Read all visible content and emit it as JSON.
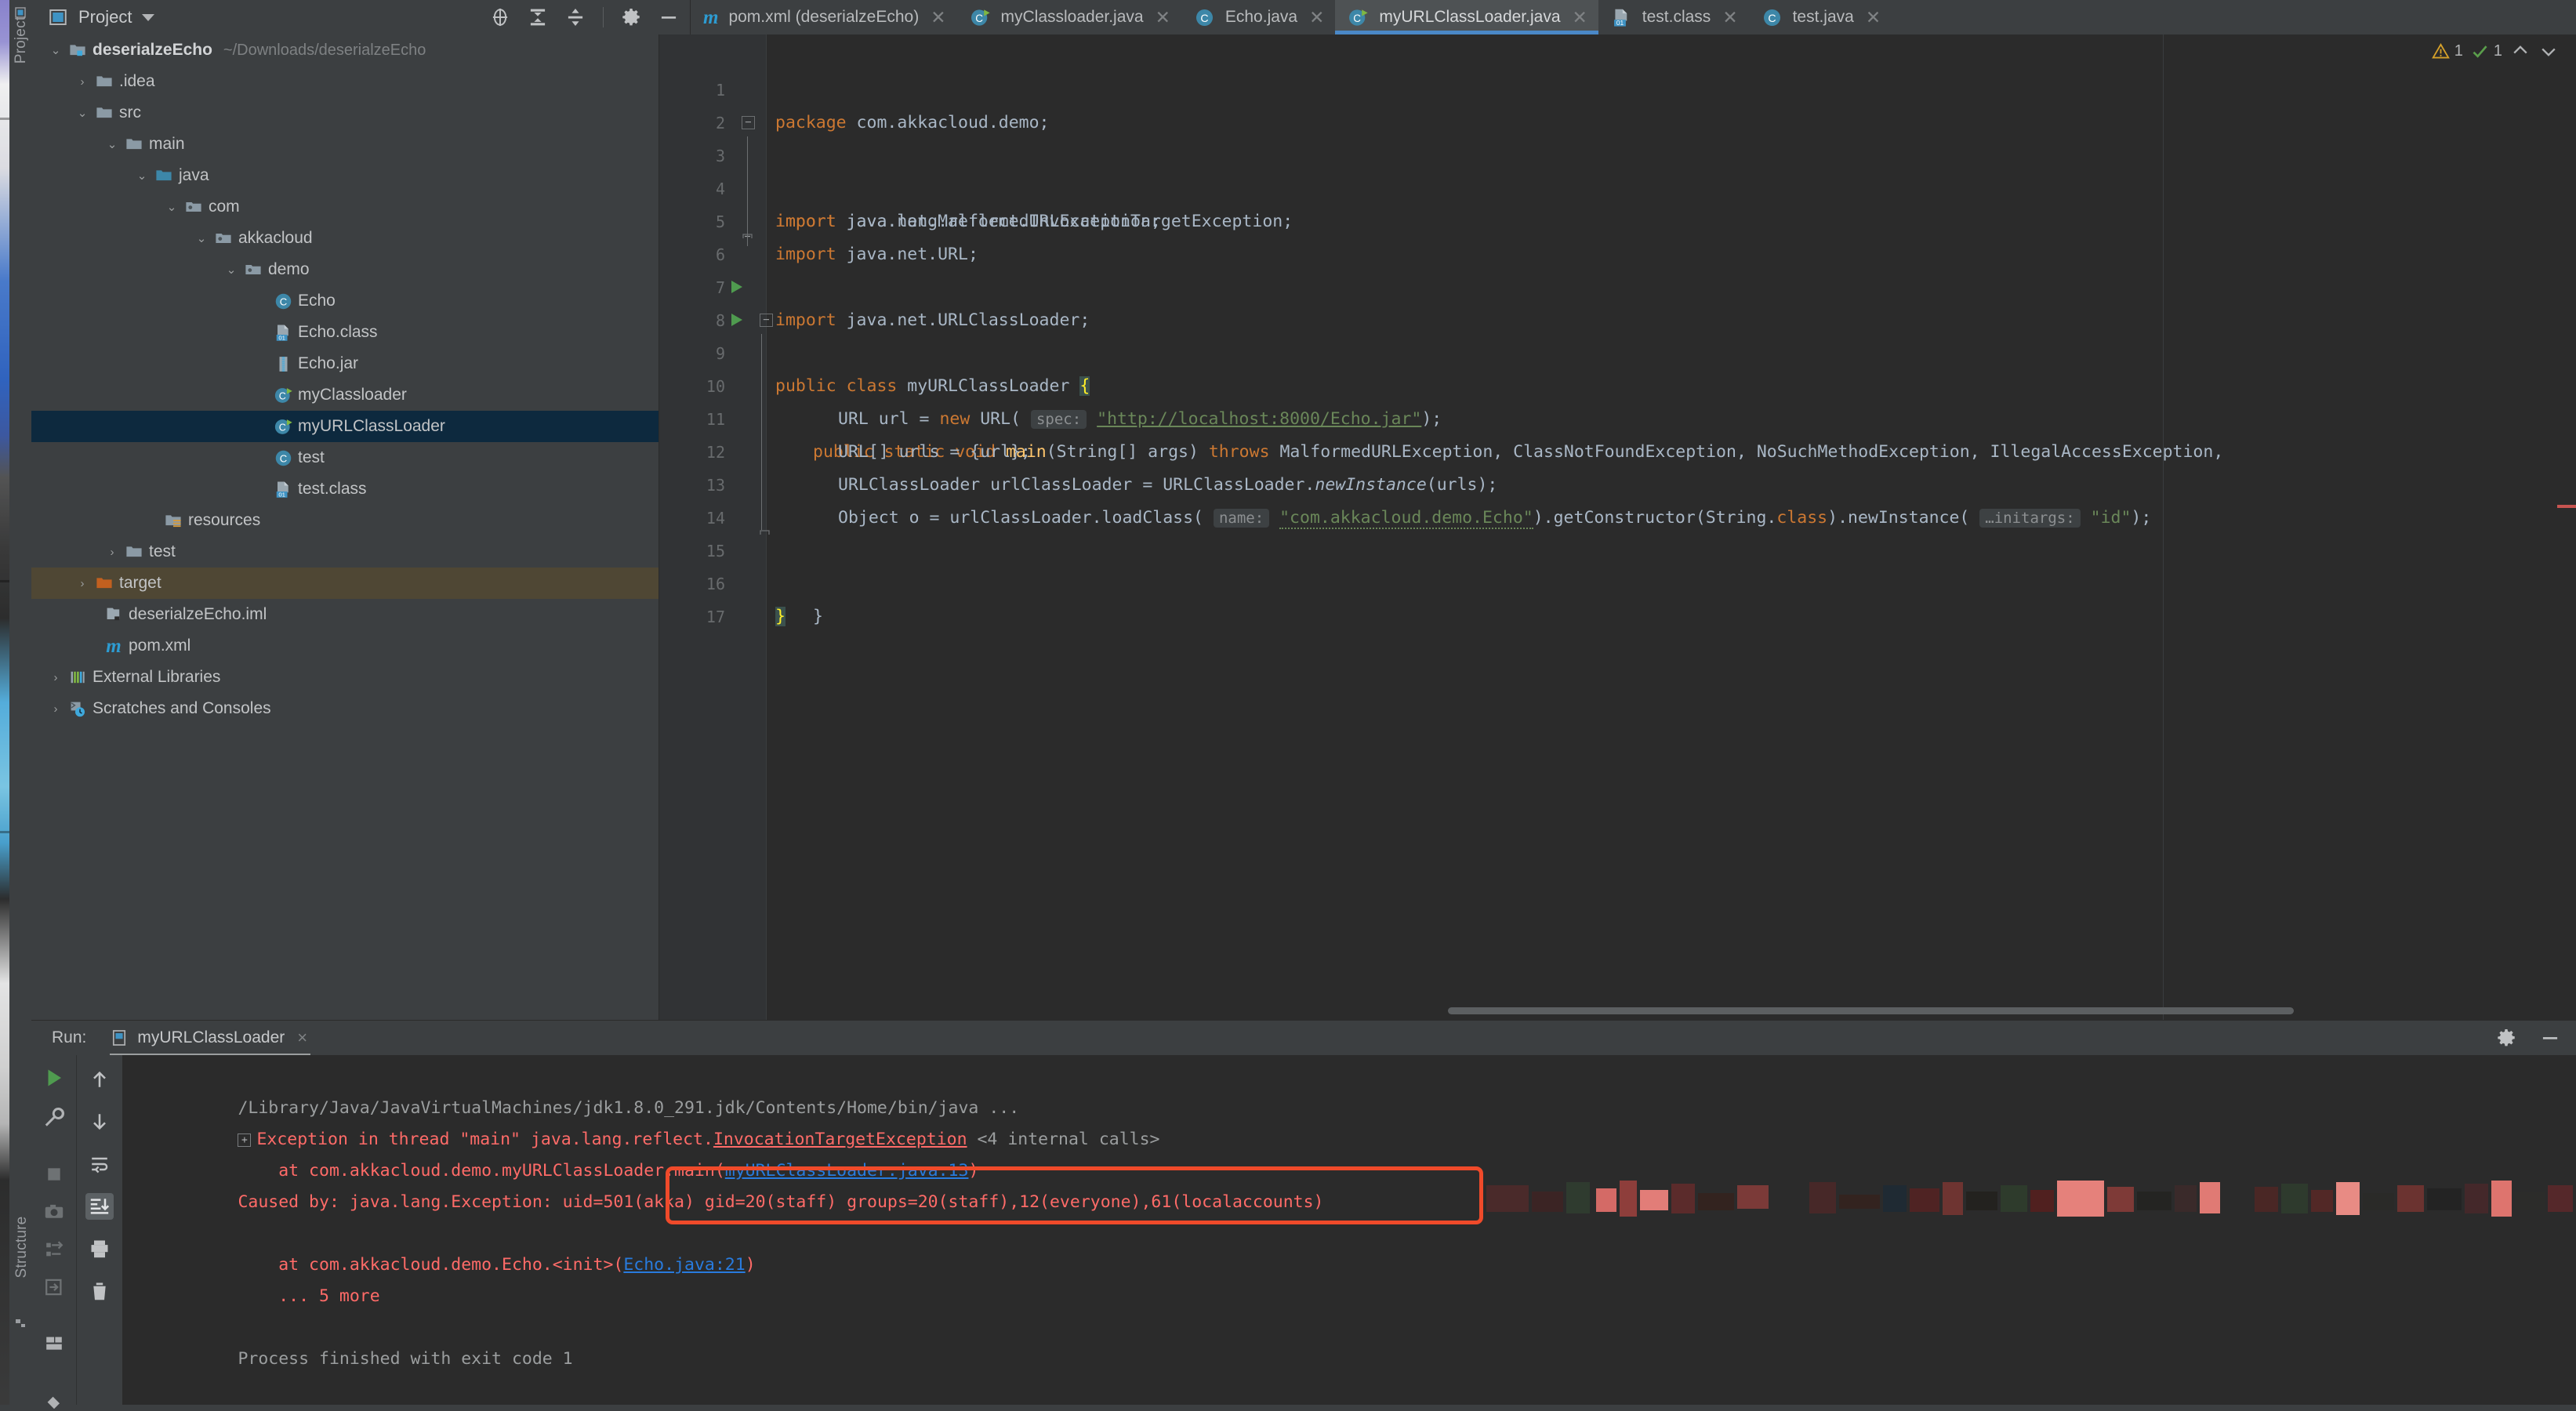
{
  "window": {
    "left_tabs": [
      {
        "label": "Project",
        "name": "tool-window-project"
      },
      {
        "label": "Structure",
        "name": "tool-window-structure"
      }
    ]
  },
  "project_panel": {
    "title": "Project",
    "icons": [
      "locate-icon",
      "expand-all-icon",
      "collapse-all-icon",
      "gear-icon",
      "minimize-icon"
    ]
  },
  "editor_tabs": [
    {
      "label": "pom.xml (deserialzeEcho)",
      "icon": "maven-icon",
      "active": false
    },
    {
      "label": "myClassloader.java",
      "icon": "java-class-run-icon",
      "active": false
    },
    {
      "label": "Echo.java",
      "icon": "java-class-icon",
      "active": false
    },
    {
      "label": "myURLClassLoader.java",
      "icon": "java-class-run-icon",
      "active": true
    },
    {
      "label": "test.class",
      "icon": "class-file-icon",
      "active": false
    },
    {
      "label": "test.java",
      "icon": "java-class-icon",
      "active": false
    }
  ],
  "tree": [
    {
      "label": "deserialzeEcho",
      "path": "~/Downloads/deserialzeEcho",
      "depth": 0,
      "twist": "down",
      "icon": "module-folder-icon",
      "bold": true,
      "state": "normal"
    },
    {
      "label": ".idea",
      "path": "",
      "depth": 1,
      "twist": "right",
      "icon": "folder-icon",
      "bold": false,
      "state": "normal"
    },
    {
      "label": "src",
      "path": "",
      "depth": 1,
      "twist": "down",
      "icon": "folder-icon",
      "bold": false,
      "state": "normal"
    },
    {
      "label": "main",
      "path": "",
      "depth": 2,
      "twist": "down",
      "icon": "folder-icon",
      "bold": false,
      "state": "normal"
    },
    {
      "label": "java",
      "path": "",
      "depth": 3,
      "twist": "down",
      "icon": "source-root-folder-icon",
      "bold": false,
      "state": "normal"
    },
    {
      "label": "com",
      "path": "",
      "depth": 4,
      "twist": "down",
      "icon": "package-icon",
      "bold": false,
      "state": "normal"
    },
    {
      "label": "akkacloud",
      "path": "",
      "depth": 5,
      "twist": "down",
      "icon": "package-icon",
      "bold": false,
      "state": "normal"
    },
    {
      "label": "demo",
      "path": "",
      "depth": 6,
      "twist": "down",
      "icon": "package-icon",
      "bold": false,
      "state": "normal"
    },
    {
      "label": "Echo",
      "path": "",
      "depth": 7,
      "twist": "none",
      "icon": "java-class-icon",
      "bold": false,
      "state": "normal"
    },
    {
      "label": "Echo.class",
      "path": "",
      "depth": 7,
      "twist": "none",
      "icon": "class-file-icon",
      "bold": false,
      "state": "normal"
    },
    {
      "label": "Echo.jar",
      "path": "",
      "depth": 7,
      "twist": "none",
      "icon": "jar-icon",
      "bold": false,
      "state": "normal"
    },
    {
      "label": "myClassloader",
      "path": "",
      "depth": 7,
      "twist": "none",
      "icon": "java-class-run-icon",
      "bold": false,
      "state": "normal"
    },
    {
      "label": "myURLClassLoader",
      "path": "",
      "depth": 7,
      "twist": "none",
      "icon": "java-class-run-icon",
      "bold": false,
      "state": "selected"
    },
    {
      "label": "test",
      "path": "",
      "depth": 7,
      "twist": "none",
      "icon": "java-class-icon",
      "bold": false,
      "state": "normal"
    },
    {
      "label": "test.class",
      "path": "",
      "depth": 7,
      "twist": "none",
      "icon": "class-file-icon",
      "bold": false,
      "state": "normal"
    },
    {
      "label": "resources",
      "path": "",
      "depth": 3,
      "twist": "none",
      "icon": "resource-root-folder-icon",
      "bold": false,
      "state": "normal"
    },
    {
      "label": "test",
      "path": "",
      "depth": 2,
      "twist": "right",
      "icon": "folder-icon",
      "bold": false,
      "state": "normal"
    },
    {
      "label": "target",
      "path": "",
      "depth": 1,
      "twist": "right",
      "icon": "excluded-folder-icon",
      "bold": false,
      "state": "highlighted"
    },
    {
      "label": "deserialzeEcho.iml",
      "path": "",
      "depth": 1,
      "twist": "none",
      "icon": "iml-file-icon",
      "bold": false,
      "state": "normal"
    },
    {
      "label": "pom.xml",
      "path": "",
      "depth": 1,
      "twist": "none",
      "icon": "maven-icon",
      "bold": false,
      "state": "normal"
    },
    {
      "label": "External Libraries",
      "path": "",
      "depth": 0,
      "twist": "right",
      "icon": "libraries-icon",
      "bold": false,
      "state": "normal"
    },
    {
      "label": "Scratches and Consoles",
      "path": "",
      "depth": 0,
      "twist": "right",
      "icon": "scratches-icon",
      "bold": false,
      "state": "normal"
    }
  ],
  "editor": {
    "line_numbers": [
      "1",
      "2",
      "3",
      "4",
      "5",
      "6",
      "7",
      "8",
      "9",
      "10",
      "11",
      "12",
      "13",
      "14",
      "15",
      "16",
      "17"
    ],
    "code_lines": {
      "l1_kw": "package",
      "l1_rest": " com.akkacloud.demo;",
      "l3_kw": "import",
      "l3_rest": " java.lang.reflect.InvocationTargetException;",
      "l4_kw": "import",
      "l4_rest": " java.net.MalformedURLException;",
      "l5_kw": "import",
      "l5_rest": " java.net.URL;",
      "l6_kw": "import",
      "l6_rest": " java.net.URLClassLoader;",
      "l8_a": "public class ",
      "l8_b": "myURLClassLoader",
      "l8_brace": "{",
      "l9_a": "public static void ",
      "l9_main": "main",
      "l9_b": "(String[] args) ",
      "l9_throws": "throws",
      "l9_c": " MalformedURLException, ClassNotFoundException, NoSuchMethodException, IllegalAccessException,",
      "l10_a": "URL url = ",
      "l10_new": "new",
      "l10_b": " URL( ",
      "l10_hint": "spec:",
      "l10_str": "\"http://localhost:8000/Echo.jar\"",
      "l10_end": ");",
      "l11": "URL[] urls = {url};",
      "l12_a": "URLClassLoader urlClassLoader = URLClassLoader.",
      "l12_m": "newInstance",
      "l12_b": "(urls);",
      "l13_a": "Object ",
      "l13_o": "o",
      "l13_b": " = urlClassLoader.loadClass( ",
      "l13_hint": "name:",
      "l13_str": "\"com.akkacloud.demo.Echo\"",
      "l13_c": ").getConstructor(String.",
      "l13_class": "class",
      "l13_d": ").newInstance( ",
      "l13_hint2": "…initargs:",
      "l13_str2": "\"id\"",
      "l13_e": ");",
      "l15": "}",
      "l16": "}"
    },
    "inspections": {
      "warnings": "1",
      "checks": "1"
    }
  },
  "run_window": {
    "label": "Run:",
    "tab_label": "myURLClassLoader",
    "close": "×",
    "left_tools": [
      "rerun-icon",
      "settings-wrench-icon",
      "stop-icon",
      "camera-icon",
      "coverage-icon",
      "export-icon",
      "layout-icon",
      "pin-icon"
    ],
    "right_tools": [
      "up-arrow-icon",
      "down-arrow-icon",
      "soft-wrap-icon",
      "scroll-to-end-icon",
      "print-icon",
      "trash-icon"
    ],
    "header_icons": [
      "gear-icon",
      "minimize-icon"
    ],
    "console": [
      {
        "type": "grey",
        "text": "/Library/Java/JavaVirtualMachines/jdk1.8.0_291.jdk/Contents/Home/bin/java ..."
      },
      {
        "type": "exception",
        "expander": "+",
        "text": "Exception in thread \"main\" java.lang.reflect.",
        "link": "InvocationTargetException",
        "suffix": " <4 internal calls>"
      },
      {
        "type": "at",
        "prefix": "    at com.akkacloud.demo.myURLClassLoader.main(",
        "link": "myURLClassLoader.java:13",
        "suffix": ")"
      },
      {
        "type": "caused",
        "prefix": "Caused by: java.lang.Exception: ",
        "boxed": "uid=501(akka) gid=20(staff) groups=20(staff),12(everyone),61(localaccounts)",
        "redacted": true
      },
      {
        "type": "blank",
        "text": ""
      },
      {
        "type": "at",
        "prefix": "    at com.akkacloud.demo.Echo.<init>(",
        "link": "Echo.java:21",
        "suffix": ")"
      },
      {
        "type": "more",
        "text": "    ... 5 more"
      },
      {
        "type": "blank",
        "text": ""
      },
      {
        "type": "grey",
        "text": "Process finished with exit code 1"
      }
    ]
  },
  "colors": {
    "accent_blue": "#4a88c7",
    "selection_blue": "#0d293e",
    "highlight_tan": "#4f4734",
    "error_red": "#ff6b68",
    "box_red": "#f04a2a",
    "keyword_orange": "#cc7832",
    "string_green": "#6a8759",
    "editor_bg": "#2b2b2b",
    "panel_bg": "#3c3f41"
  }
}
